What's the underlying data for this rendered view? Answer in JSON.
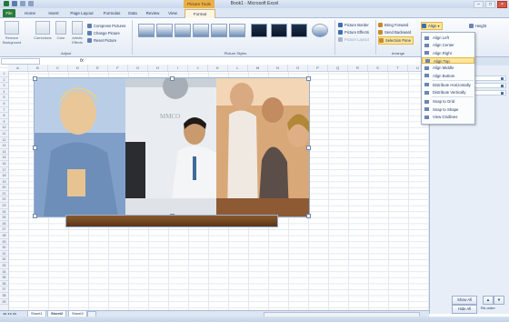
{
  "window": {
    "title": "Book1 - Microsoft Excel",
    "context_tab": "Picture Tools"
  },
  "tabs": [
    "File",
    "Home",
    "Insert",
    "Page Layout",
    "Formulas",
    "Data",
    "Review",
    "View",
    "Format"
  ],
  "ribbon": {
    "adjust_group": {
      "label": "Adjust",
      "remove_background": "Remove Background",
      "corrections": "Corrections",
      "color": "Color",
      "artistic_effects": "Artistic Effects",
      "compress": "Compress Pictures",
      "change": "Change Picture",
      "reset": "Reset Picture"
    },
    "styles_group": {
      "label": "Picture Styles",
      "border": "Picture Border",
      "effects": "Picture Effects",
      "layout": "Picture Layout"
    },
    "arrange_group": {
      "label": "Arrange",
      "bring_forward": "Bring Forward",
      "send_backward": "Send Backward",
      "selection_pane": "Selection Pane",
      "align": "Align"
    },
    "size_group": {
      "label": "Size",
      "height_label": "Height"
    }
  },
  "formula_bar": {
    "fx": "fx"
  },
  "columns": [
    "A",
    "B",
    "C",
    "D",
    "E",
    "F",
    "G",
    "H",
    "I",
    "J",
    "K",
    "L",
    "M",
    "N",
    "O",
    "P",
    "Q",
    "R",
    "S",
    "T",
    "U"
  ],
  "align_menu": [
    {
      "label": "Align Left",
      "highlight": false
    },
    {
      "label": "Align Center",
      "highlight": false
    },
    {
      "label": "Align Right",
      "highlight": false
    },
    {
      "label": "Align Top",
      "highlight": true
    },
    {
      "label": "Align Middle",
      "highlight": false
    },
    {
      "label": "Align Bottom",
      "highlight": false
    },
    {
      "label": "Distribute Horizontally",
      "highlight": false
    },
    {
      "label": "Distribute Vertically",
      "highlight": false
    },
    {
      "label": "Snap to Grid",
      "highlight": false
    },
    {
      "label": "Snap to Shape",
      "highlight": false
    },
    {
      "label": "View Gridlines",
      "highlight": false
    }
  ],
  "selection_pane": {
    "header": "Selection and Visibility",
    "show_all": "Show All",
    "hide_all": "Hide All",
    "reorder": "Re-order"
  },
  "sheets": [
    "Sheet1",
    "Sheet2",
    "Sheet3"
  ],
  "active_sheet": "Sheet2",
  "colors": {
    "file_tab": "#2a7a3a",
    "context_tag": "#e8b04a",
    "highlight": "#fde59a"
  }
}
